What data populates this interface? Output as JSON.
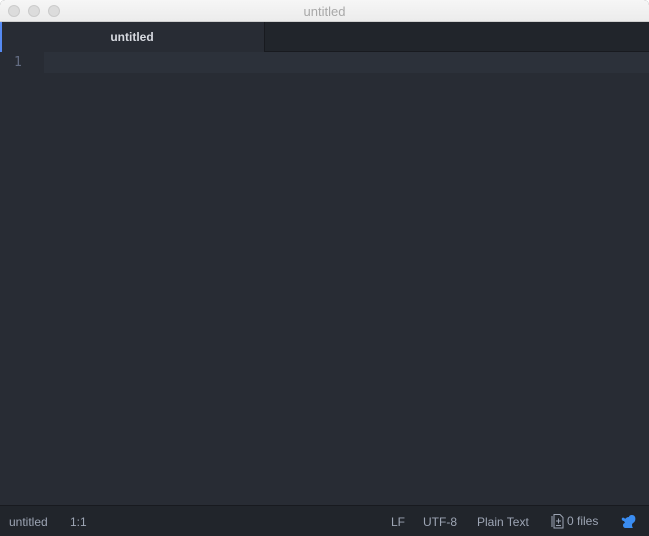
{
  "window": {
    "title": "untitled"
  },
  "tabs": [
    {
      "label": "untitled",
      "active": true
    }
  ],
  "editor": {
    "line_numbers": [
      "1"
    ],
    "content": ""
  },
  "status_bar": {
    "file_name": "untitled",
    "cursor_position": "1:1",
    "line_ending": "LF",
    "encoding": "UTF-8",
    "grammar": "Plain Text",
    "files_icon": "file-diff-icon",
    "files_count": "0 files",
    "squirrel_icon": "squirrel-icon"
  },
  "colors": {
    "accent": "#568af2",
    "squirrel": "#3a8cf0",
    "editor_bg": "#282c34"
  }
}
